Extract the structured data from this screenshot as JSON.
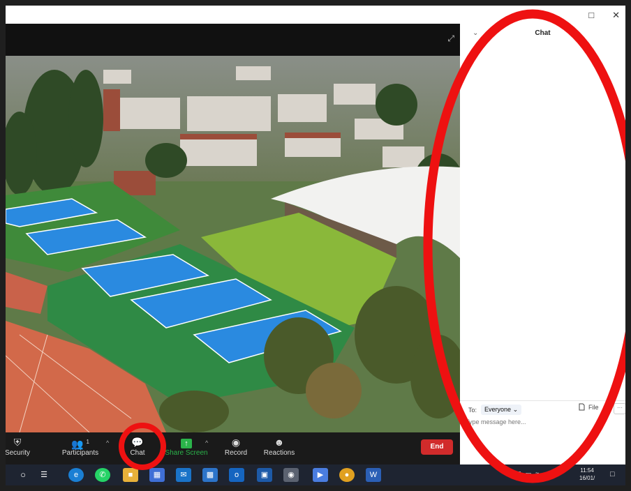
{
  "window": {
    "restore_glyph": "□",
    "close_glyph": "✕"
  },
  "video": {
    "expand_glyph": "⤢"
  },
  "toolbar": {
    "items": [
      {
        "label": "Security",
        "icon": "shield-icon",
        "glyph": "⛨"
      },
      {
        "label": "Participants",
        "icon": "people-icon",
        "glyph": "👥",
        "count": "1"
      },
      {
        "label": "Chat",
        "icon": "chat-bubble-icon",
        "glyph": "💬"
      },
      {
        "label": "Share Screen",
        "icon": "share-screen-icon",
        "glyph": "↑"
      },
      {
        "label": "Record",
        "icon": "record-icon",
        "glyph": "◉"
      },
      {
        "label": "Reactions",
        "icon": "reactions-icon",
        "glyph": "☻"
      }
    ],
    "caret": "^",
    "end_label": "End",
    "share_color": "#2bb34a",
    "end_color": "#d12b2b"
  },
  "chat": {
    "title": "Chat",
    "collapse_glyph": "⌄",
    "to_label": "To:",
    "recipient": "Everyone",
    "recipient_caret": "⌄",
    "file_label": "File",
    "more_glyph": "···",
    "placeholder": "Type message here..."
  },
  "taskbar": {
    "time": "11:54",
    "date": "16/01/",
    "apps": [
      "start-circle-icon",
      "task-view-icon",
      "edge-icon",
      "whatsapp-icon",
      "file-explorer-icon",
      "store-icon",
      "mail-icon",
      "calendar-icon",
      "outlook-icon",
      "generic-app-icon",
      "camera-icon",
      "zoom-icon",
      "chrome-icon",
      "word-icon"
    ]
  },
  "annotation_color": "#ee1111"
}
